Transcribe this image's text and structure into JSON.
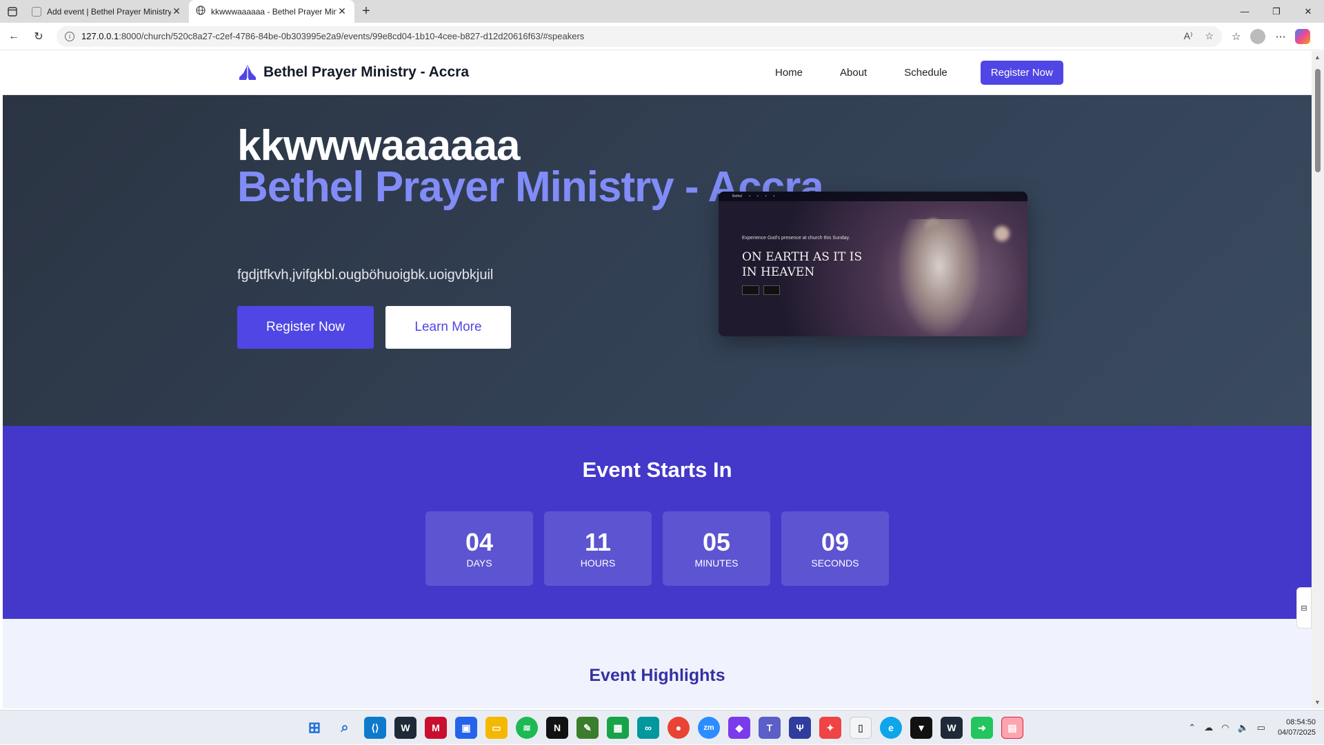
{
  "browser": {
    "tabs": [
      {
        "title": "Add event | Bethel Prayer Ministry",
        "active": false
      },
      {
        "title": "kkwwwaaaaaa - Bethel Prayer Mini",
        "active": true
      }
    ],
    "url_host": "127.0.0.1",
    "url_rest": ":8000/church/520c8a27-c2ef-4786-84be-0b303995e2a9/events/99e8cd04-1b10-4cee-b827-d12d20616f63/#speakers"
  },
  "site": {
    "brand": "Bethel Prayer Ministry - Accra",
    "nav": {
      "home": "Home",
      "about": "About",
      "schedule": "Schedule",
      "register": "Register Now"
    }
  },
  "hero": {
    "title_line1": "kkwwwaaaaaa",
    "title_line2": "Bethel Prayer Ministry - Accra",
    "subtitle": "fgdjtfkvh,jvifgkbl.ougböhuoigbk.uoigvbkjuil",
    "primary_button": "Register Now",
    "secondary_button": "Learn More",
    "image": {
      "kicker": "Experience God's presence at church this Sunday.",
      "headline": "ON EARTH AS IT IS IN HEAVEN"
    }
  },
  "countdown": {
    "title": "Event Starts In",
    "units": [
      {
        "value": "04",
        "label": "DAYS"
      },
      {
        "value": "11",
        "label": "HOURS"
      },
      {
        "value": "05",
        "label": "MINUTES"
      },
      {
        "value": "09",
        "label": "SECONDS"
      }
    ]
  },
  "highlights": {
    "title": "Event Highlights"
  },
  "system": {
    "time": "08:54:50",
    "date": "04/07/2025"
  },
  "colors": {
    "accent": "#4f46e5",
    "hero_bg": "#334155",
    "countdown_bg": "#4338ca",
    "highlight_title": "#3730a3"
  }
}
